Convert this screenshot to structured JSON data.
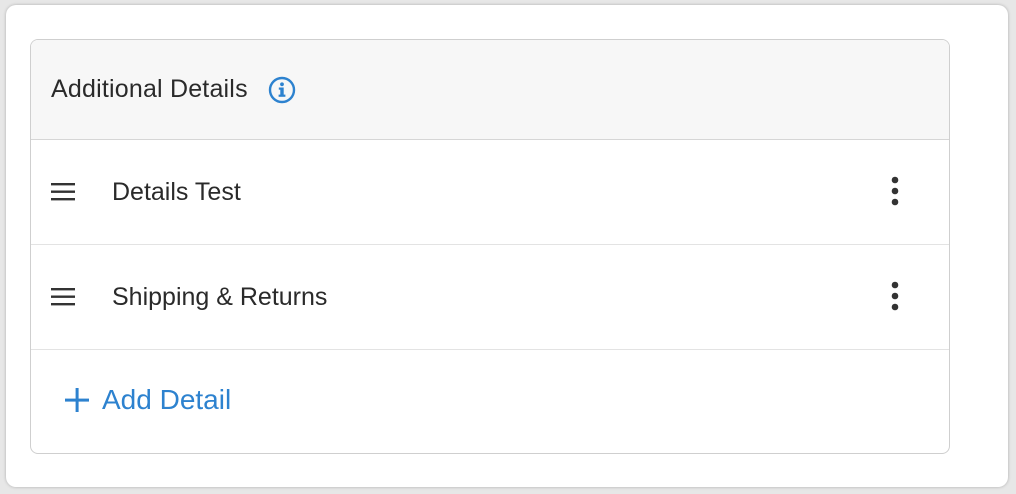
{
  "section": {
    "title": "Additional Details",
    "info_icon": "info-circle-icon"
  },
  "details": [
    {
      "label": "Details Test",
      "handle_icon": "drag-handle-icon",
      "menu_icon": "more-vertical-icon"
    },
    {
      "label": "Shipping & Returns",
      "handle_icon": "drag-handle-icon",
      "menu_icon": "more-vertical-icon"
    }
  ],
  "add_button": {
    "label": "Add Detail",
    "icon": "plus-icon"
  },
  "colors": {
    "accent": "#2d82cf",
    "text": "#2a2a2a",
    "header_bg": "#f7f7f7"
  }
}
